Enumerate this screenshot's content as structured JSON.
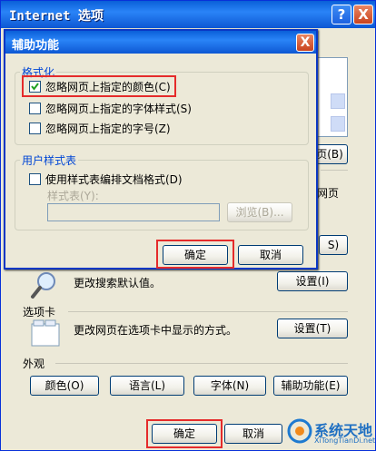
{
  "window": {
    "title": "Internet 选项",
    "help": "?",
    "close": "X"
  },
  "main": {
    "right_btn_b": "页(B)",
    "right_text_1": "网页",
    "right_btn_s": "S)",
    "search_text": "更改搜索默认值。",
    "search_settings": "设置(I)",
    "tabs_section": "选项卡",
    "tabs_text": "更改网页在选项卡中显示的方式。",
    "tabs_settings": "设置(T)",
    "appearance_section": "外观",
    "btn_colors": "颜色(O)",
    "btn_languages": "语言(L)",
    "btn_fonts": "字体(N)",
    "btn_accessibility": "辅助功能(E)",
    "ok": "确定",
    "cancel_partial": "取消"
  },
  "dialog": {
    "title": "辅助功能",
    "close": "X",
    "format_group": "格式化",
    "cb1": "忽略网页上指定的颜色(C)",
    "cb2": "忽略网页上指定的字体样式(S)",
    "cb3": "忽略网页上指定的字号(Z)",
    "userstyle_group": "用户样式表",
    "cb4": "使用样式表编排文档格式(D)",
    "stylesheet_label": "样式表(Y):",
    "browse": "浏览(B)...",
    "ok": "确定",
    "cancel": "取消"
  },
  "watermark": {
    "text": "系统天地",
    "sub": "XiTongTianDi.net"
  },
  "colors": {
    "title_bar": "#0a5fd8",
    "highlight": "#e52b2b",
    "group_title": "#0046d5"
  }
}
